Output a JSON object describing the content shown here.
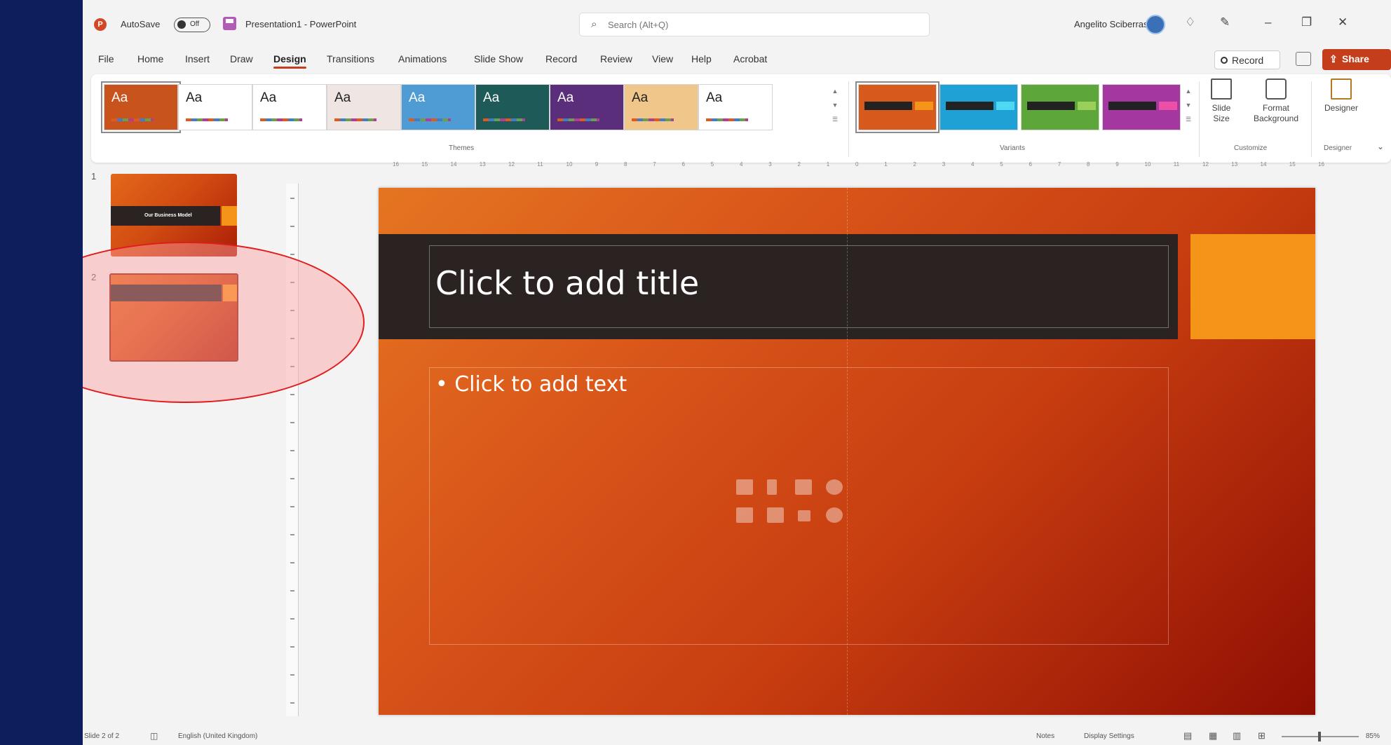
{
  "titlebar": {
    "autosave_label": "AutoSave",
    "autosave_state": "Off",
    "document": "Presentation1  -  PowerPoint",
    "search_placeholder": "Search (Alt+Q)",
    "user": "Angelito Sciberras"
  },
  "tabs": [
    "File",
    "Home",
    "Insert",
    "Draw",
    "Design",
    "Transitions",
    "Animations",
    "Slide Show",
    "Record",
    "Review",
    "View",
    "Help",
    "Acrobat"
  ],
  "active_tab": "Design",
  "record_label": "Record",
  "share_label": "Share",
  "ribbon": {
    "themes_label": "Themes",
    "variants_label": "Variants",
    "customize_label": "Customize",
    "designer_group_label": "Designer",
    "themes": [
      {
        "aa": "Aa",
        "bg": "#c9531c"
      },
      {
        "aa": "Aa",
        "bg": "#ffffff"
      },
      {
        "aa": "Aa",
        "bg": "#ffffff"
      },
      {
        "aa": "Aa",
        "bg": "#efe6e3"
      },
      {
        "aa": "Aa",
        "bg": "#4e9cd3"
      },
      {
        "aa": "Aa",
        "bg": "#1e5a58"
      },
      {
        "aa": "Aa",
        "bg": "#5a2e7a"
      },
      {
        "aa": "Aa",
        "bg": "#f0c68a"
      },
      {
        "aa": "Aa",
        "bg": "#ffffff"
      }
    ],
    "variants": [
      {
        "bg": "#d55a1b",
        "accent": "#f49419"
      },
      {
        "bg": "#1fa1d6",
        "accent": "#4fd8f4"
      },
      {
        "bg": "#5da63a",
        "accent": "#9ad05a"
      },
      {
        "bg": "#a438a0",
        "accent": "#ee4fa6"
      }
    ],
    "slide_size_label": "Slide\nSize",
    "format_background_label": "Format\nBackground",
    "designer_label": "Designer"
  },
  "thumbnails": [
    {
      "num": "1",
      "title": "Our Business Model"
    },
    {
      "num": "2",
      "title": ""
    }
  ],
  "slide": {
    "title_placeholder": "Click to add title",
    "body_placeholder": "• Click to add text"
  },
  "ruler_labels": [
    "16",
    "15",
    "14",
    "13",
    "12",
    "11",
    "10",
    "9",
    "8",
    "7",
    "6",
    "5",
    "4",
    "3",
    "2",
    "1",
    "0",
    "1",
    "2",
    "3",
    "4",
    "5",
    "6",
    "7",
    "8",
    "9",
    "10",
    "11",
    "12",
    "13",
    "14",
    "15",
    "16"
  ],
  "status": {
    "slide_info": "Slide 2 of 2",
    "language": "English (United Kingdom)",
    "notes": "Notes",
    "display_settings": "Display Settings",
    "zoom": "85%"
  },
  "colors": {
    "accent_red": "#c43e1c",
    "slide_band": "#2a2322",
    "slide_accent": "#f49419",
    "annotation_ellipse": "#e01c1c"
  }
}
